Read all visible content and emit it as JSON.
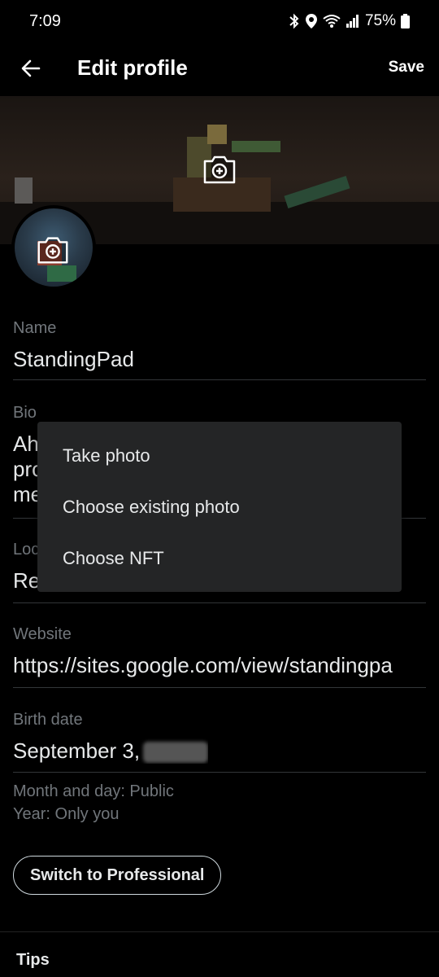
{
  "status_bar": {
    "time": "7:09",
    "battery": "75%",
    "icons": [
      "bluetooth-icon",
      "location-icon",
      "wifi-icon",
      "signal-icon",
      "battery-icon"
    ]
  },
  "app_bar": {
    "title": "Edit profile",
    "save_label": "Save",
    "back_icon": "arrow-left-icon"
  },
  "header_photo": {
    "camera_icon": "camera-plus-icon"
  },
  "form": {
    "name": {
      "label": "Name",
      "value": "StandingPad"
    },
    "bio": {
      "label": "Bio",
      "lines": [
        "Ah",
        "pro",
        "me"
      ]
    },
    "location": {
      "label": "Loc",
      "value": "Re"
    },
    "website": {
      "label": "Website",
      "value": "https://sites.google.com/view/standingpa"
    },
    "birth_date": {
      "label": "Birth date",
      "value": "September 3,"
    }
  },
  "privacy": {
    "month_day": "Month and day: Public",
    "year": "Year: Only you"
  },
  "switch_button": "Switch to Professional",
  "tips_heading": "Tips",
  "photo_menu": {
    "items": [
      "Take photo",
      "Choose existing photo",
      "Choose NFT"
    ]
  },
  "colors": {
    "background": "#000000",
    "menu_bg": "#242526",
    "muted_text": "#71767b",
    "text": "#e7e9ea"
  }
}
